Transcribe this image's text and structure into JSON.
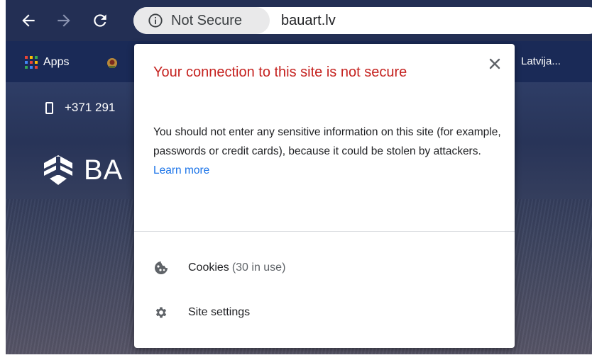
{
  "toolbar": {
    "back_icon": "arrow-left-icon",
    "forward_icon": "arrow-right-icon",
    "reload_icon": "reload-icon",
    "security_chip_label": "Not Secure",
    "security_icon": "info-icon",
    "url": "bauart.lv"
  },
  "bookmarks": {
    "apps_label": "Apps",
    "truncated_item": "Latvija..."
  },
  "page": {
    "phone": "+371 291",
    "logo_text": "BA"
  },
  "popup": {
    "title": "Your connection to this site is not secure",
    "body": "You should not enter any sensitive information on this site (for example, passwords or credit cards), because it could be stolen by attackers.",
    "learn_more": "Learn more",
    "cookies_label": "Cookies",
    "cookies_count": "(30 in use)",
    "site_settings_label": "Site settings",
    "title_color": "#c5221f",
    "link_color": "#1a73e8"
  }
}
